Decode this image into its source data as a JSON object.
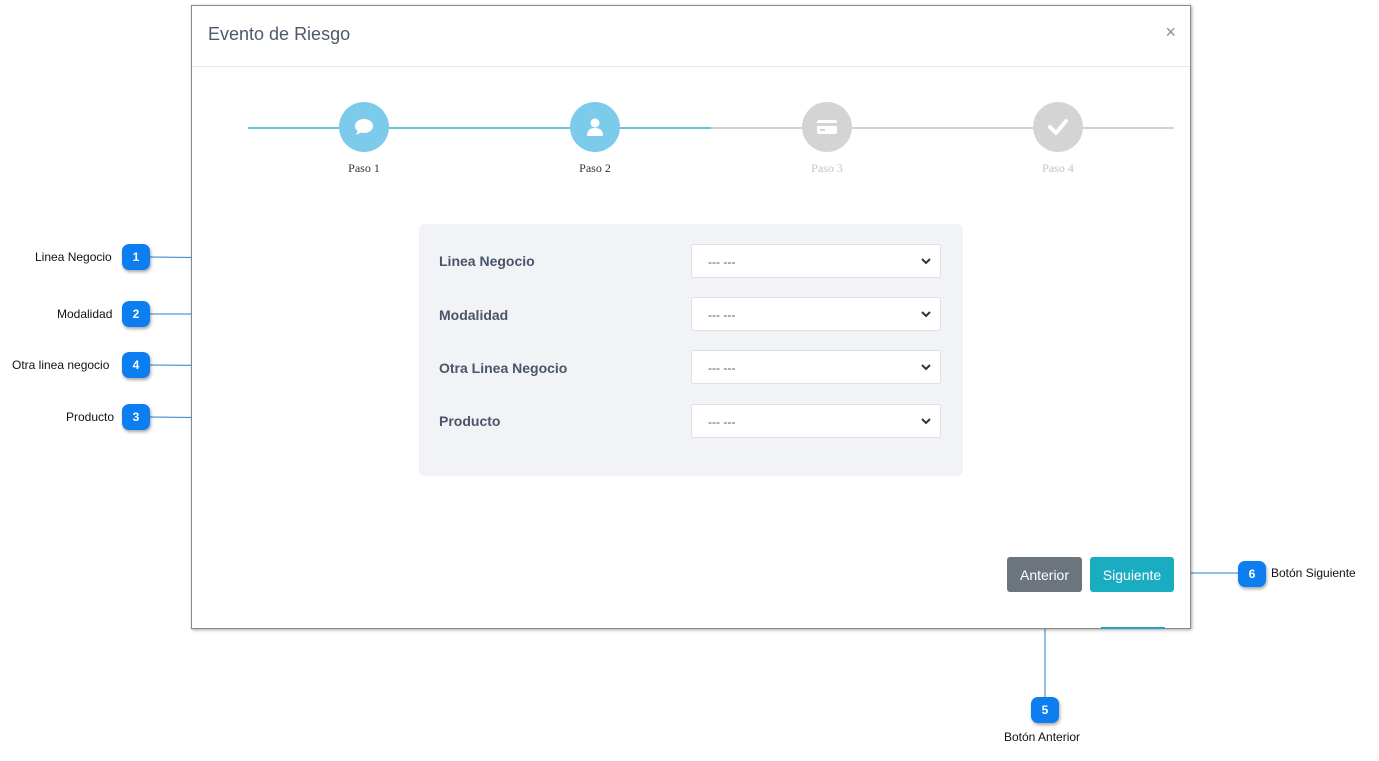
{
  "modal": {
    "title": "Evento de Riesgo",
    "close_symbol": "×"
  },
  "steps": [
    {
      "label": "Paso 1",
      "icon": "chat-bubble-icon",
      "state": "active"
    },
    {
      "label": "Paso 2",
      "icon": "user-icon",
      "state": "active"
    },
    {
      "label": "Paso 3",
      "icon": "credit-card-icon",
      "state": "inactive"
    },
    {
      "label": "Paso 4",
      "icon": "check-icon",
      "state": "inactive"
    }
  ],
  "form": {
    "fields": [
      {
        "label": "Linea Negocio",
        "value": "--- ---"
      },
      {
        "label": "Modalidad",
        "value": "--- ---"
      },
      {
        "label": "Otra Linea Negocio",
        "value": "--- ---"
      },
      {
        "label": "Producto",
        "value": "--- ---"
      }
    ]
  },
  "buttons": {
    "prev_label": "Anterior",
    "next_label": "Siguiente"
  },
  "callouts": [
    {
      "number": "1",
      "text": "Linea Negocio"
    },
    {
      "number": "2",
      "text": "Modalidad"
    },
    {
      "number": "4",
      "text": "Otra linea negocio"
    },
    {
      "number": "3",
      "text": "Producto"
    },
    {
      "number": "5",
      "text": "Botón Anterior"
    },
    {
      "number": "6",
      "text": "Botón Siguiente"
    }
  ],
  "colors": {
    "step_active": "#7dcbea",
    "step_inactive": "#d4d4d4",
    "btn_prev": "#6c757d",
    "btn_next": "#1aadc2",
    "callout": "#0d7ef0"
  }
}
